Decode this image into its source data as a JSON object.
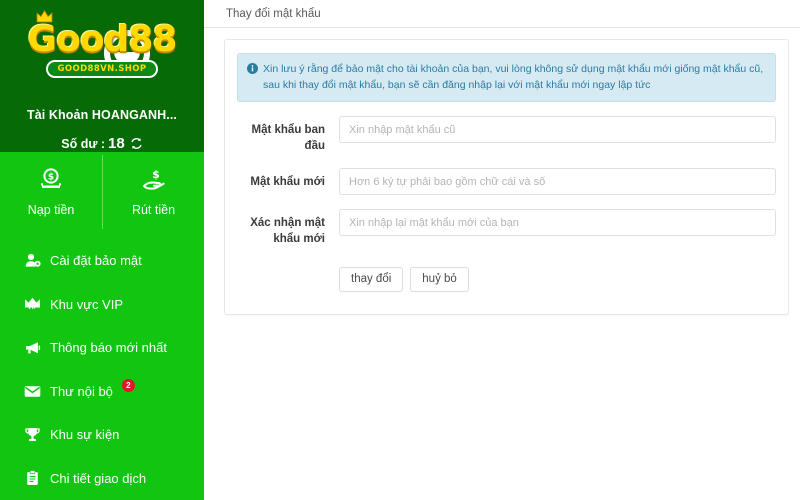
{
  "sidebar": {
    "logo": {
      "name": "Good88",
      "crown_icon": "crown-icon",
      "badge": "GOOD88VN.SHOP"
    },
    "account": {
      "name": "Tài Khoản HOANGANH...",
      "balance_label": "Số dư :",
      "balance_value": "18",
      "refresh_icon": "refresh-icon"
    },
    "quick_actions": [
      {
        "label": "Nạp tiền",
        "icon": "deposit-coin-icon"
      },
      {
        "label": "Rút tiền",
        "icon": "withdraw-hand-coin-icon"
      }
    ],
    "menu": [
      {
        "label": "Cài đặt bảo mật",
        "icon": "user-gear-icon",
        "badge": ""
      },
      {
        "label": "Khu vực VIP",
        "icon": "vip-crown-icon",
        "badge": ""
      },
      {
        "label": "Thông báo mới nhất",
        "icon": "megaphone-icon",
        "badge": ""
      },
      {
        "label": "Thư nội bộ",
        "icon": "envelope-icon",
        "badge": "2"
      },
      {
        "label": "Khu sự kiện",
        "icon": "trophy-icon",
        "badge": ""
      },
      {
        "label": "Chi tiết giao dịch",
        "icon": "clipboard-icon",
        "badge": ""
      }
    ]
  },
  "main": {
    "header_title": "Thay đổi mật khẩu",
    "alert": {
      "icon": "info-circle-icon",
      "text": "Xin lưu ý rằng để bảo mật cho tài khoản của bạn, vui lòng không sử dụng mật khẩu mới giống mật khẩu cũ, sau khi thay đổi mật khẩu, bạn sẽ cần đăng nhập lại với mật khẩu mới ngay lập tức"
    },
    "form": {
      "fields": [
        {
          "label": "Mật khẩu ban đầu",
          "placeholder": "Xin nhập mật khẩu cũ",
          "value": ""
        },
        {
          "label": "Mật khẩu mới",
          "placeholder": "Hơn 6 ký tự phải bao gồm chữ cái và số",
          "value": ""
        },
        {
          "label": "Xác nhận mật khẩu mới",
          "placeholder": "Xin nhập lại mật khẩu mới của bạn",
          "value": ""
        }
      ],
      "submit_label": "thay đổi",
      "cancel_label": "huỷ bỏ"
    }
  },
  "colors": {
    "sidebar_bright_green": "#11c511",
    "sidebar_dark_green": "#066b06",
    "logo_gold": "#ffd900",
    "badge_red": "#e8142a",
    "alert_bg": "#d6eaf4",
    "alert_text": "#2c7ba0"
  }
}
